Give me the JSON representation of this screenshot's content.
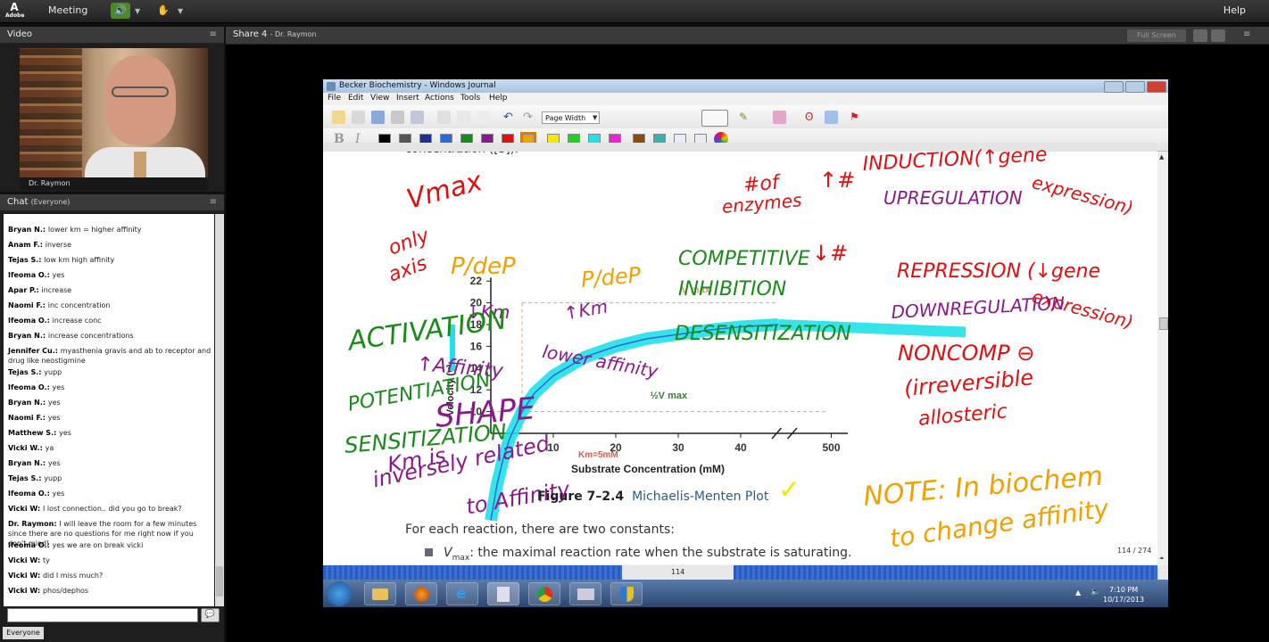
{
  "app": {
    "logo_letter": "A",
    "logo_text": "Adobe",
    "menu_meeting": "Meeting",
    "help": "Help"
  },
  "video_pod": {
    "title": "Video",
    "presenter_name": "Dr. Raymon"
  },
  "share_pod": {
    "title": "Share 4",
    "presenter": "- Dr. Raymon",
    "full_screen": "Full Screen"
  },
  "chat_pod": {
    "title": "Chat",
    "audience": "(Everyone)",
    "messages": [
      {
        "sender": "Bryan N.:",
        "text": "lower km = higher affinity"
      },
      {
        "sender": "Anam F.:",
        "text": "inverse"
      },
      {
        "sender": "Tejas S.:",
        "text": "low km high affinity"
      },
      {
        "sender": "Ifeoma O.:",
        "text": "yes"
      },
      {
        "sender": "Apar P.:",
        "text": "increase"
      },
      {
        "sender": "Naomi F.:",
        "text": "inc concentration"
      },
      {
        "sender": "Ifeoma O.:",
        "text": "increase conc"
      },
      {
        "sender": "Bryan N.:",
        "text": "increase concentrations"
      },
      {
        "sender": "Jennifer Cu.:",
        "text": "myasthenia gravis and ab to receptor and drug like neostigmine"
      },
      {
        "sender": "Tejas S.:",
        "text": "yupp"
      },
      {
        "sender": "Ifeoma O.:",
        "text": "yes"
      },
      {
        "sender": "Bryan N.:",
        "text": "yes"
      },
      {
        "sender": "Naomi F.:",
        "text": "yes"
      },
      {
        "sender": "Matthew S.:",
        "text": "yes"
      },
      {
        "sender": "Vicki W.:",
        "text": "ya"
      },
      {
        "sender": "Bryan N.:",
        "text": "yes"
      },
      {
        "sender": "Tejas S.:",
        "text": "yupp"
      },
      {
        "sender": "Ifeoma O.:",
        "text": "yes"
      },
      {
        "sender": "Vicki W:",
        "text": "I lost connection.. did you go to break?"
      },
      {
        "sender": "Dr. Raymon:",
        "text": "I will leave the room for a few minutes since there are no questions for me right now if you don't mind!"
      },
      {
        "sender": "Ifeoma O.:",
        "text": "yes we are on break vicki"
      },
      {
        "sender": "Vicki W:",
        "text": "ty"
      },
      {
        "sender": "Vicki W:",
        "text": "did I miss much?"
      },
      {
        "sender": "Vicki W:",
        "text": "phos/dephos"
      }
    ],
    "recipient": "Everyone"
  },
  "journal": {
    "window_title": "Becker Biochemistry - Windows Journal",
    "menu": [
      "File",
      "Edit",
      "View",
      "Insert",
      "Actions",
      "Tools",
      "Help"
    ],
    "zoom": "Page Width",
    "pen_colors": [
      "#000000",
      "#555555",
      "#1e2f9a",
      "#2a6ad8",
      "#1a8a1a",
      "#8a1a8a",
      "#e01010",
      "#f0a000",
      "#f8e800",
      "#20d020",
      "#20e0e8",
      "#f020d0",
      "#8a4a10",
      "#3ab0b0",
      "#e8ecf4",
      "#e8ecf4"
    ],
    "page_indicator": "114 / 274",
    "scroll_page": "114"
  },
  "slide": {
    "cut_text": "concentration ([S]).",
    "figure_label": "Figure 7–2.4",
    "figure_title": "Michaelis-Menten Plot",
    "constants_intro": "For each reaction, there are two constants:",
    "vmax_symbol": "V",
    "vmax_sub": "max",
    "vmax_def": ": the maximal reaction rate when the substrate is saturating."
  },
  "chart_data": {
    "type": "line",
    "title": "",
    "xlabel": "Substrate Concentration (mM)",
    "ylabel": "Velocity (v)",
    "x_ticks": [
      "10",
      "20",
      "30",
      "40",
      "500"
    ],
    "y_ticks": [
      "22",
      "20",
      "18",
      "16",
      "14",
      "12",
      "10"
    ],
    "xlim": [
      0,
      50
    ],
    "ylim": [
      8,
      22
    ],
    "series": [
      {
        "name": "",
        "x": [
          1,
          2,
          3,
          5,
          7,
          10,
          15,
          20,
          25,
          30,
          35,
          40,
          46
        ],
        "y": [
          3.3,
          5.7,
          7.5,
          10,
          11.7,
          13.3,
          15,
          16,
          16.7,
          17.1,
          17.5,
          17.8,
          18.0
        ]
      }
    ],
    "annotations": [
      "V max",
      "½V max",
      "Km=5mM"
    ],
    "vmax_level": 20,
    "half_vmax_level": 10,
    "km": 5
  },
  "ink_notes": [
    {
      "text": "Vmax",
      "color": "#e01010"
    },
    {
      "text": "only",
      "color": "#e01010"
    },
    {
      "text": "axis",
      "color": "#e01010"
    },
    {
      "text": "P/deP",
      "color": "#f0a000"
    },
    {
      "text": "P/deP",
      "color": "#f0a000"
    },
    {
      "text": "↓Km",
      "color": "#8a1a8a"
    },
    {
      "text": "↑Km",
      "color": "#8a1a8a"
    },
    {
      "text": "ACTIVATION",
      "color": "#1a8a1a"
    },
    {
      "text": "↑Affinity",
      "color": "#8a1a8a"
    },
    {
      "text": "POTENTIATION",
      "color": "#1a8a1a"
    },
    {
      "text": "SHAPE",
      "color": "#8a1a8a"
    },
    {
      "text": "SENSITIZATION",
      "color": "#1a8a1a"
    },
    {
      "text": "lower affinity",
      "color": "#8a1a8a"
    },
    {
      "text": "Km is",
      "color": "#8a1a8a"
    },
    {
      "text": "inversely related",
      "color": "#8a1a8a"
    },
    {
      "text": "to Affinity",
      "color": "#8a1a8a"
    },
    {
      "text": "#of",
      "color": "#e01010"
    },
    {
      "text": "enzymes",
      "color": "#e01010"
    },
    {
      "text": "↑#",
      "color": "#e01010"
    },
    {
      "text": "↓#",
      "color": "#e01010"
    },
    {
      "text": "COMPETITIVE",
      "color": "#1a8a1a"
    },
    {
      "text": "INHIBITION",
      "color": "#1a8a1a"
    },
    {
      "text": "DESENSITIZATION",
      "color": "#1a8a1a"
    },
    {
      "text": "INDUCTION(↑gene",
      "color": "#e01010"
    },
    {
      "text": "expression)",
      "color": "#e01010"
    },
    {
      "text": "UPREGULATION",
      "color": "#8a1a8a"
    },
    {
      "text": "REPRESSION (↓gene",
      "color": "#e01010"
    },
    {
      "text": "expression)",
      "color": "#e01010"
    },
    {
      "text": "DOWNREGULATION",
      "color": "#8a1a8a"
    },
    {
      "text": "NONCOMP ⊖",
      "color": "#e01010"
    },
    {
      "text": "(irreversible",
      "color": "#e01010"
    },
    {
      "text": "allosteric",
      "color": "#e01010"
    },
    {
      "text": "NOTE: In biochem",
      "color": "#f0a000"
    },
    {
      "text": "to change affinity",
      "color": "#f0a000"
    }
  ]
}
